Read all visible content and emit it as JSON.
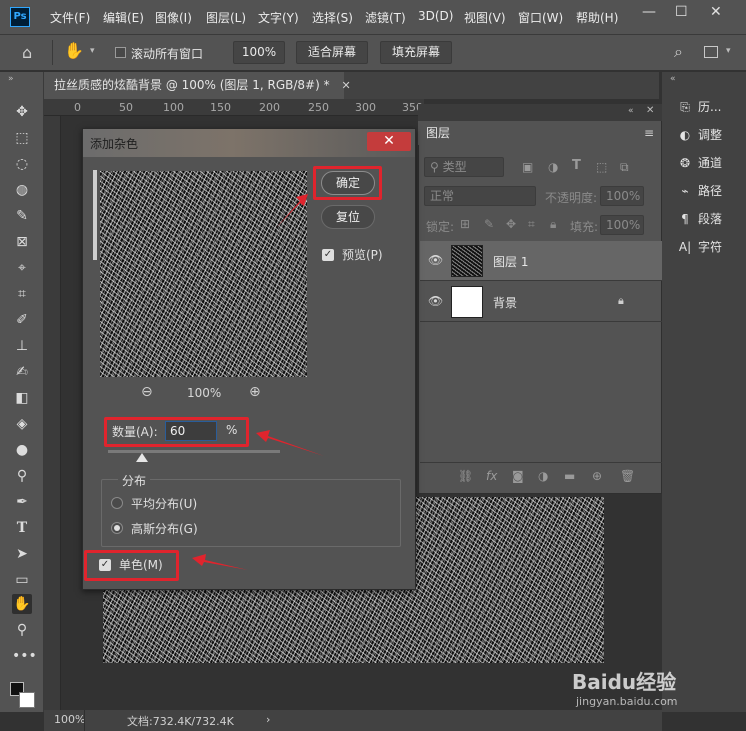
{
  "app": {
    "logo": "Ps"
  },
  "menubar": {
    "items": [
      "文件(F)",
      "编辑(E)",
      "图像(I)",
      "图层(L)",
      "文字(Y)",
      "选择(S)",
      "滤镜(T)",
      "3D(D)",
      "视图(V)",
      "窗口(W)",
      "帮助(H)"
    ],
    "window_controls": [
      "—",
      "☐",
      "✕"
    ]
  },
  "options_bar": {
    "scroll_all_label": "滚动所有窗口",
    "zoom_value": "100%",
    "fit_screen_label": "适合屏幕",
    "fill_screen_label": "填充屏幕"
  },
  "document": {
    "tab_title": "拉丝质感的炫酷背景 @ 100% (图层 1, RGB/8#) *",
    "tab_close": "✕",
    "ruler_marks": [
      "0",
      "50",
      "100",
      "150",
      "200",
      "250",
      "300",
      "350"
    ]
  },
  "right_panel": {
    "items": [
      {
        "label": "历...",
        "icon": "history-icon"
      },
      {
        "label": "调整",
        "icon": "adjustments-icon"
      },
      {
        "label": "通道",
        "icon": "channels-icon"
      },
      {
        "label": "路径",
        "icon": "paths-icon"
      },
      {
        "label": "段落",
        "icon": "paragraph-icon"
      },
      {
        "label": "字符",
        "icon": "character-icon"
      }
    ]
  },
  "layers_panel": {
    "tab_label": "图层",
    "filter_placeholder": "类型",
    "blend_mode": "正常",
    "opacity_label": "不透明度:",
    "opacity_value": "100%",
    "lock_label": "锁定:",
    "fill_label": "填充:",
    "fill_value": "100%",
    "layers": [
      {
        "name": "图层 1",
        "selected": true
      },
      {
        "name": "背景",
        "locked": true
      }
    ]
  },
  "dialog": {
    "title": "添加杂色",
    "close": "✕",
    "ok_label": "确定",
    "reset_label": "复位",
    "preview_label": "预览(P)",
    "zoom_value": "100%",
    "amount_label": "数量(A):",
    "amount_value": "60",
    "amount_unit": "%",
    "distribution_label": "分布",
    "uniform_label": "平均分布(U)",
    "gaussian_label": "高斯分布(G)",
    "monochrome_label": "单色(M)",
    "amount_slider_fraction": 0.2
  },
  "status_bar": {
    "zoom": "100%",
    "doc_info": "文档:732.4K/732.4K",
    "arrow": "›"
  },
  "watermark": {
    "brand": "Baidu经验",
    "url": "jingyan.baidu.com"
  },
  "colors": {
    "accent_red": "#e0242d",
    "dialog_close_red": "#c43c3c",
    "ps_blue": "#31a8ff"
  }
}
